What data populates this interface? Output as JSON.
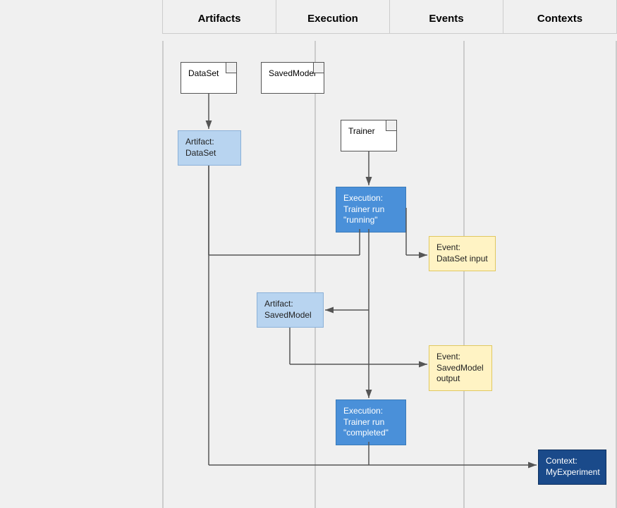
{
  "columns": [
    {
      "label": "Artifacts"
    },
    {
      "label": "Execution"
    },
    {
      "label": "Events"
    },
    {
      "label": "Contexts"
    }
  ],
  "nodes": {
    "dataset_type": {
      "text": "DataSet"
    },
    "savedmodel_type": {
      "text": "SavedModel"
    },
    "trainer_type": {
      "text": "Trainer"
    },
    "artifact_dataset": {
      "text": "Artifact:\nDataSet"
    },
    "artifact_savedmodel": {
      "text": "Artifact:\nSavedModel"
    },
    "execution_running": {
      "text": "Execution:\nTrainer run\n\"running\""
    },
    "execution_completed": {
      "text": "Execution:\nTrainer run\n\"completed\""
    },
    "event_dataset_input": {
      "text": "Event:\nDataSet input"
    },
    "event_savedmodel_output": {
      "text": "Event:\nSavedModel\noutput"
    },
    "context_myexperiment": {
      "text": "Context:\nMyExperiment"
    }
  }
}
